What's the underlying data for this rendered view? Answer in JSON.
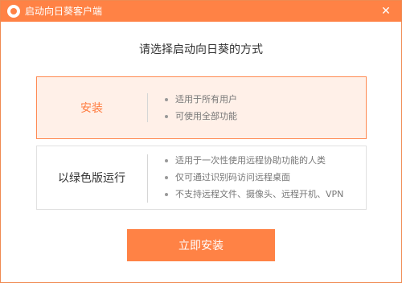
{
  "window": {
    "title": "启动向日葵客户端",
    "close_glyph": "✕",
    "accent_color": "#ff8245"
  },
  "heading": "请选择启动向日葵的方式",
  "options": [
    {
      "label": "安装",
      "selected": true,
      "features": [
        "适用于所有用户",
        "可使用全部功能"
      ]
    },
    {
      "label": "以绿色版运行",
      "selected": false,
      "features": [
        "适用于一次性使用远程协助功能的人类",
        "仅可通过识别码访问远程桌面",
        "不支持远程文件、摄像头、远程开机、VPN"
      ]
    }
  ],
  "install_button": "立即安装"
}
